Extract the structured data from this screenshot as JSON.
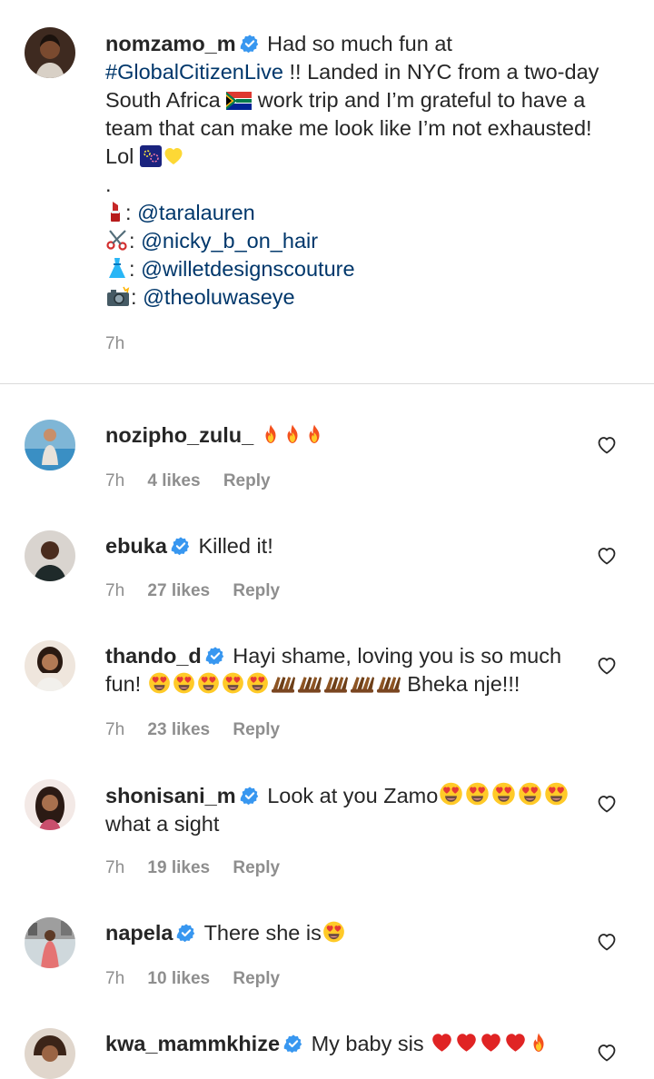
{
  "post": {
    "username": "nomzamo_m",
    "caption_line1": "Had so much fun at",
    "hashtag": "#GlobalCitizenLive",
    "caption_line2_rest": "!! Landed in NYC from a two-day",
    "caption_line3_a": "South Africa",
    "caption_line3_b": "work trip and I’m grateful to have a",
    "caption_line4": "team that can make me look like I’m not exhausted!",
    "caption_line5": "Lol",
    "dot": ".",
    "credits": [
      {
        "icon": "lipstick-emoji",
        "sep": ":",
        "handle": "@taralauren"
      },
      {
        "icon": "scissors-emoji",
        "sep": ":",
        "handle": "@nicky_b_on_hair"
      },
      {
        "icon": "dress-emoji",
        "sep": ":",
        "handle": "@willetdesignscouture"
      },
      {
        "icon": "camera-flash-emoji",
        "sep": ":",
        "handle": "@theoluwaseye"
      }
    ],
    "time": "7h"
  },
  "comments": [
    {
      "username": "nozipho_zulu_",
      "verified": false,
      "text": "",
      "emojis": "fire x3",
      "time": "7h",
      "likes": "4 likes",
      "reply": "Reply"
    },
    {
      "username": "ebuka",
      "verified": true,
      "text": "Killed it!",
      "time": "7h",
      "likes": "27 likes",
      "reply": "Reply"
    },
    {
      "username": "thando_d",
      "verified": true,
      "text_line1": "Hayi shame, loving you is so much",
      "text_line2_a": "fun!",
      "text_line2_b": "Bheka nje!!!",
      "time": "7h",
      "likes": "23 likes",
      "reply": "Reply"
    },
    {
      "username": "shonisani_m",
      "verified": true,
      "text_line1": "Look at you Zamo",
      "text_line2": "what a sight",
      "time": "7h",
      "likes": "19 likes",
      "reply": "Reply"
    },
    {
      "username": "napela",
      "verified": true,
      "text": "There she is",
      "time": "7h",
      "likes": "10 likes",
      "reply": "Reply"
    },
    {
      "username": "kwa_mammkhize",
      "verified": true,
      "text": "My baby sis"
    }
  ],
  "colors": {
    "link": "#00376b",
    "verified": "#3897f0",
    "meta": "#8e8e8e",
    "text": "#262626"
  }
}
